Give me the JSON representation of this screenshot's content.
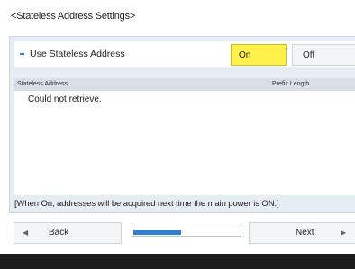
{
  "screen": {
    "title": "<Stateless Address Settings>"
  },
  "option": {
    "label": "Use Stateless Address",
    "choices": [
      "On",
      "Off"
    ],
    "selected": "On",
    "accent_color": "#fff14a"
  },
  "address_list": {
    "columns": [
      "Stateless Address",
      "Prefix Length"
    ],
    "empty_message": "Could not retrieve."
  },
  "note": "[When On, addresses will be acquired next time the main power is ON.]",
  "navigation": {
    "back_label": "Back",
    "next_label": "Next",
    "back_icon": "left-arrow-icon",
    "next_icon": "right-arrow-icon",
    "progress_fraction": 0.45,
    "progress_color": "#2e7fd6"
  }
}
